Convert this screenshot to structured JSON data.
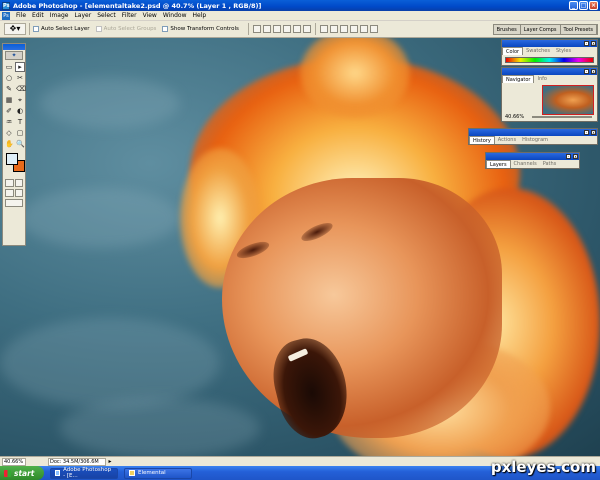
{
  "window": {
    "title": "Adobe Photoshop - [elementaltake2.psd @ 40.7% (Layer 1 , RGB/8)]",
    "app_icon": "photoshop-icon",
    "controls": [
      "_",
      "□",
      "×"
    ]
  },
  "menubar": {
    "items": [
      "File",
      "Edit",
      "Image",
      "Layer",
      "Select",
      "Filter",
      "View",
      "Window",
      "Help"
    ]
  },
  "options_bar": {
    "active_tool": "move-tool-icon",
    "auto_select_layer": "Auto Select Layer",
    "auto_select_groups": "Auto Select Groups",
    "show_transform_controls": "Show Transform Controls",
    "palette_well_tabs": [
      "Brushes",
      "Layer Comps",
      "Tool Presets"
    ]
  },
  "toolbox": {
    "tools": [
      "▭",
      "▸",
      "○",
      "✂",
      "✎",
      "⌫",
      "▦",
      "⌖",
      "✐",
      "◐",
      "♒",
      "T",
      "◇",
      "▢",
      "✋",
      "🔍"
    ]
  },
  "panels": {
    "color": {
      "tabs": [
        "Color",
        "Swatches",
        "Styles"
      ]
    },
    "navigator": {
      "tabs": [
        "Navigator",
        "Info"
      ],
      "zoom": "40.66%"
    },
    "history": {
      "tabs": [
        "History",
        "Actions",
        "Histogram"
      ]
    },
    "layers": {
      "tabs": [
        "Layers",
        "Channels",
        "Paths"
      ]
    }
  },
  "status": {
    "zoom": "40.66%",
    "doc_size": "Doc: 34.5M/306.6M"
  },
  "taskbar": {
    "start": "start",
    "items": [
      {
        "label": "Adobe Photoshop - [E...",
        "active": true
      },
      {
        "label": "Elemental",
        "active": false
      }
    ]
  },
  "watermark": "pxleyes.com",
  "colors": {
    "fg_swatch": "#e0f0f8",
    "bg_swatch": "#e86a1a",
    "titlebar": "#0a5fd8"
  }
}
